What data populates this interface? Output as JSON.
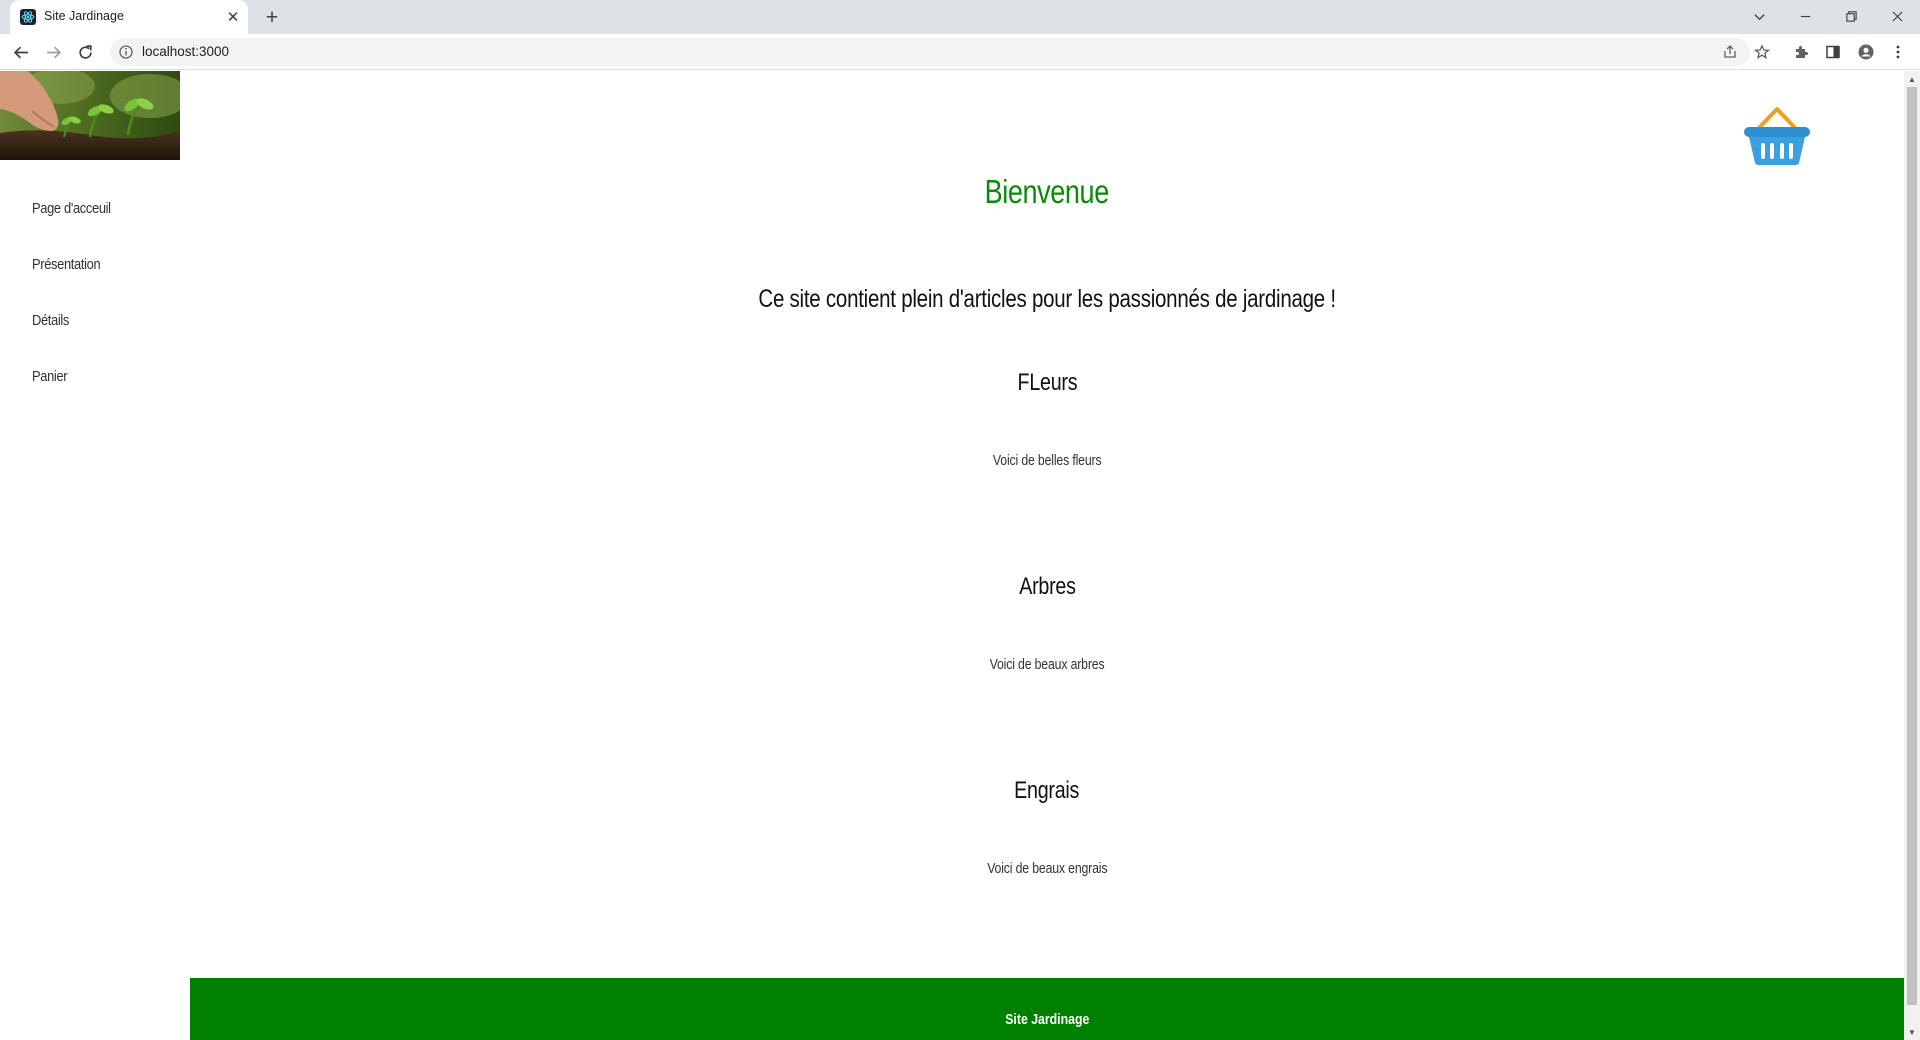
{
  "browser": {
    "tab_title": "Site Jardinage",
    "url": "localhost:3000",
    "tab_close_glyph": "✕",
    "new_tab_glyph": "+"
  },
  "nav": {
    "items": [
      {
        "label": "Page d'acceuil"
      },
      {
        "label": "Présentation"
      },
      {
        "label": "Détails"
      },
      {
        "label": "Panier"
      }
    ]
  },
  "main": {
    "welcome": "Bienvenue",
    "intro": "Ce site contient plein d'articles pour les passionnés de jardinage !",
    "sections": [
      {
        "title": "FLeurs",
        "text": "Voici de belles fleurs"
      },
      {
        "title": "Arbres",
        "text": "Voici de beaux arbres"
      },
      {
        "title": "Engrais",
        "text": "Voici de beaux engrais"
      }
    ]
  },
  "footer": {
    "text": "Site Jardinage"
  },
  "colors": {
    "accent_green": "#008000",
    "title_green": "#0a8a0a",
    "basket_blue": "#3aa0e0",
    "basket_handle": "#f0a020"
  },
  "icons": {
    "logo": "seedling-photo",
    "basket": "shopping-basket-icon"
  }
}
